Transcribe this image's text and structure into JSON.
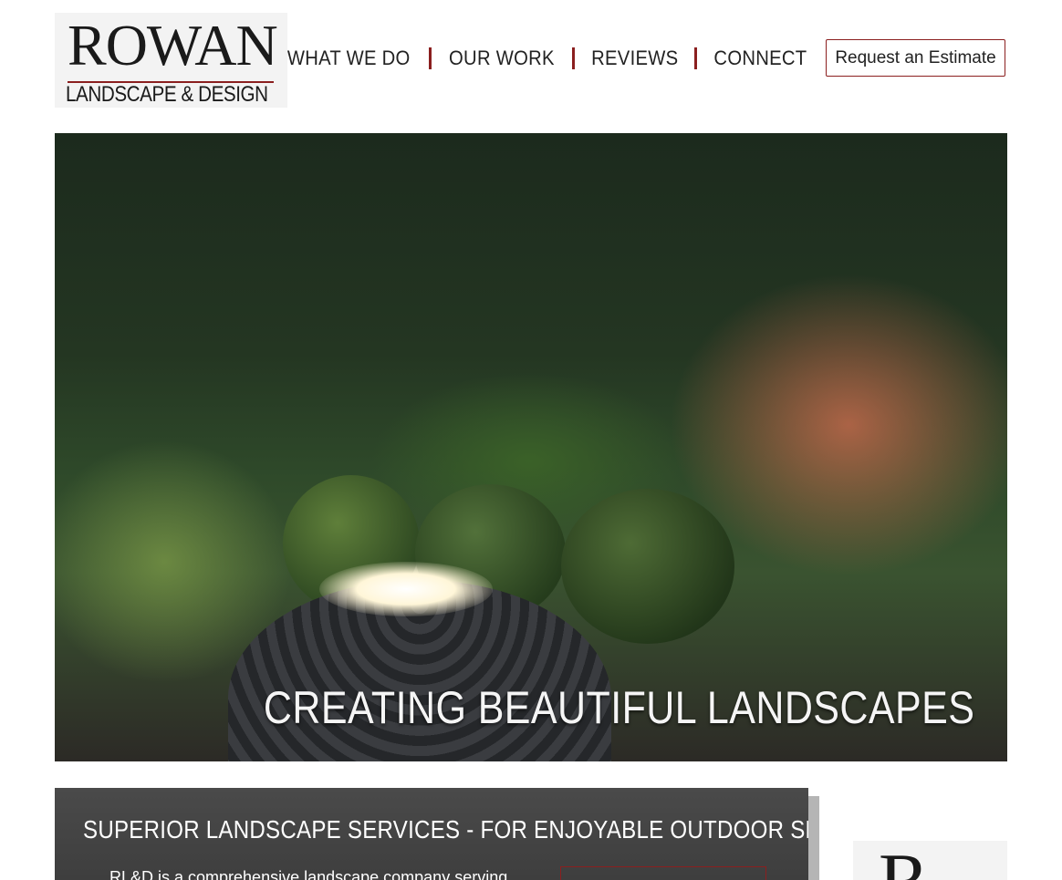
{
  "brand": {
    "logo_name": "ROWAN",
    "logo_subtitle": "LANDSCAPE & DESIGN",
    "accent_color": "#8b1f1f"
  },
  "nav": {
    "items": [
      {
        "label": "WHAT WE DO"
      },
      {
        "label": "OUR WORK"
      },
      {
        "label": "REVIEWS"
      },
      {
        "label": "CONNECT"
      }
    ],
    "cta_label": "Request an Estimate"
  },
  "hero": {
    "caption": "CREATING BEAUTIFUL LANDSCAPES"
  },
  "services": {
    "title": "SUPERIOR LANDSCAPE SERVICES - FOR ENJOYABLE OUTDOOR SPACES",
    "body": "RL&D is a comprehensive landscape company serving"
  },
  "side_logo": {
    "letter": "R"
  }
}
